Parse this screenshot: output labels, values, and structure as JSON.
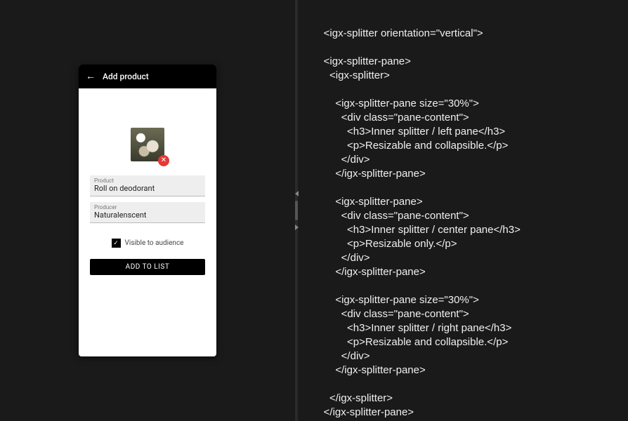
{
  "phone": {
    "title": "Add product",
    "fields": {
      "product": {
        "label": "Product",
        "value": "Roll on deodorant"
      },
      "producer": {
        "label": "Producer",
        "value": "Naturalenscent"
      }
    },
    "visibility_label": "Visible to audience",
    "add_button": "ADD TO LIST"
  },
  "code_snippet": "<igx-splitter orientation=\"vertical\">\n\n    <igx-splitter-pane>\n      <igx-splitter>\n\n        <igx-splitter-pane size=\"30%\">\n          <div class=\"pane-content\">\n            <h3>Inner splitter / left pane</h3>\n            <p>Resizable and collapsible.</p>\n          </div>\n        </igx-splitter-pane>\n\n        <igx-splitter-pane>\n          <div class=\"pane-content\">\n            <h3>Inner splitter / center pane</h3>\n            <p>Resizable only.</p>\n          </div>\n        </igx-splitter-pane>\n\n        <igx-splitter-pane size=\"30%\">\n          <div class=\"pane-content\">\n            <h3>Inner splitter / right pane</h3>\n            <p>Resizable and collapsible.</p>\n          </div>\n        </igx-splitter-pane>\n\n      </igx-splitter>\n    </igx-splitter-pane>"
}
